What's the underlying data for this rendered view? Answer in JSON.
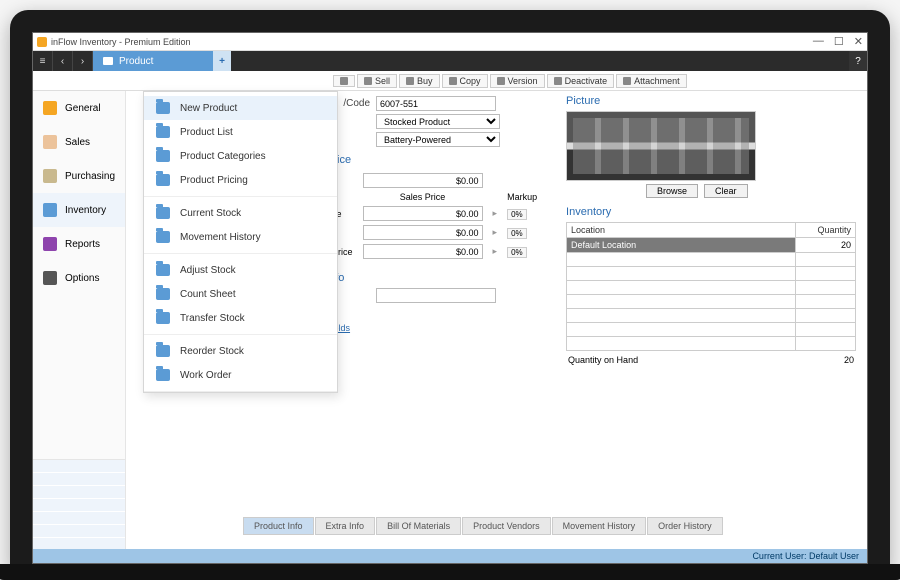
{
  "window": {
    "title": "inFlow Inventory - Premium Edition",
    "controls": {
      "min": "—",
      "max": "☐",
      "close": "✕",
      "help": "?"
    }
  },
  "tabstrip": {
    "nav": {
      "menu": "≡",
      "back": "‹",
      "fwd": "›"
    },
    "tab_label": "Product",
    "add": "+"
  },
  "toolbar": [
    {
      "key": "save",
      "label": ""
    },
    {
      "key": "sell",
      "label": "Sell"
    },
    {
      "key": "buy",
      "label": "Buy"
    },
    {
      "key": "copy",
      "label": "Copy"
    },
    {
      "key": "version",
      "label": "Version"
    },
    {
      "key": "deactivate",
      "label": "Deactivate"
    },
    {
      "key": "attachment",
      "label": "Attachment"
    }
  ],
  "sidebar": [
    {
      "key": "general",
      "label": "General"
    },
    {
      "key": "sales",
      "label": "Sales"
    },
    {
      "key": "purchasing",
      "label": "Purchasing"
    },
    {
      "key": "inventory",
      "label": "Inventory",
      "selected": true
    },
    {
      "key": "reports",
      "label": "Reports"
    },
    {
      "key": "options",
      "label": "Options"
    }
  ],
  "submenu": [
    [
      "New Product",
      "Product List",
      "Product Categories",
      "Product Pricing"
    ],
    [
      "Current Stock",
      "Movement History"
    ],
    [
      "Adjust Stock",
      "Count Sheet",
      "Transfer Stock"
    ],
    [
      "Reorder Stock",
      "Work Order"
    ]
  ],
  "form": {
    "code_label": "/Code",
    "code": "6007-551",
    "type": "Stocked Product",
    "category": "Battery-Powered",
    "price_header": "Price",
    "cost_value": "$0.00",
    "sales_price_label": "Sales Price",
    "markup_label": "Markup",
    "rows": [
      {
        "price": "$0.00",
        "pct": "0%"
      },
      {
        "price": "$0.00",
        "pct": "0%"
      },
      {
        "price": "$0.00",
        "pct": "0%"
      }
    ],
    "row_label_suffix_1": "ce",
    "row_label_suffix_2": "Price",
    "info_header": "Info",
    "fields_link": "Fields"
  },
  "picture": {
    "header": "Picture",
    "browse": "Browse",
    "clear": "Clear"
  },
  "inventory": {
    "header": "Inventory",
    "col_location": "Location",
    "col_quantity": "Quantity",
    "row_location": "Default Location",
    "row_qty": "20",
    "qoh_label": "Quantity on Hand",
    "qoh_value": "20"
  },
  "bottom_tabs": [
    "Product Info",
    "Extra Info",
    "Bill Of Materials",
    "Product Vendors",
    "Movement History",
    "Order History"
  ],
  "statusbar": {
    "label": "Current User:",
    "value": "Default User"
  },
  "colors": {
    "accent": "#5b9bd5",
    "link": "#2b6cb0"
  }
}
